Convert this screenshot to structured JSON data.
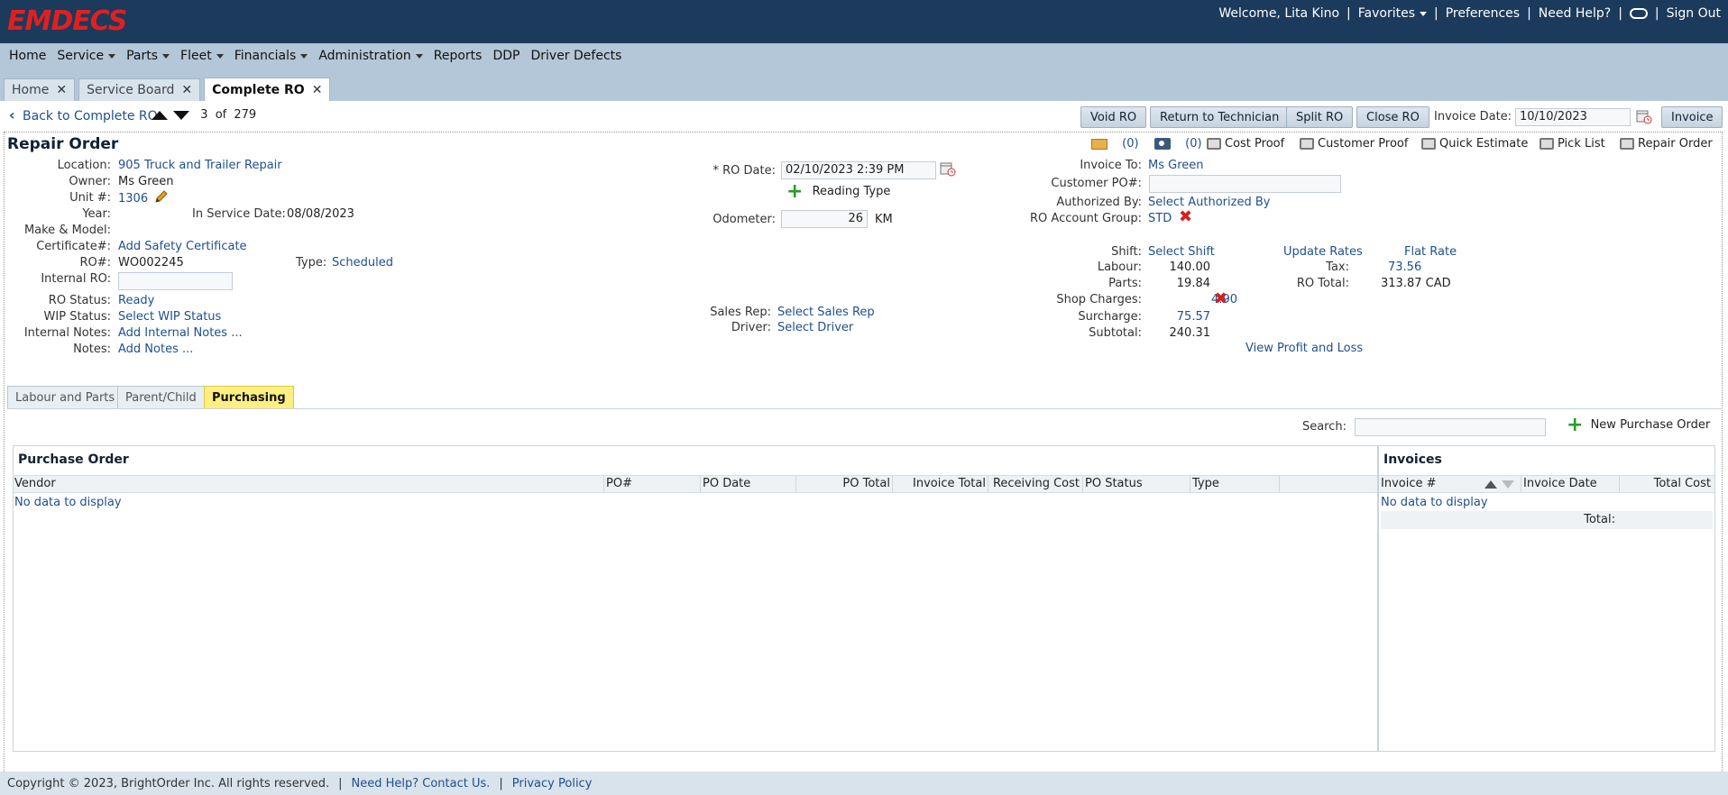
{
  "brand": {
    "logo": "EMDECS",
    "logo_color": "#e02020"
  },
  "topbar": {
    "welcome": "Welcome, Lita Kino",
    "favorites": "Favorites",
    "preferences": "Preferences",
    "help": "Need Help?",
    "signout": "Sign Out"
  },
  "nav": {
    "home": "Home",
    "service": "Service",
    "parts": "Parts",
    "fleet": "Fleet",
    "financials": "Financials",
    "administration": "Administration",
    "reports": "Reports",
    "ddp": "DDP",
    "driver_defects": "Driver Defects"
  },
  "tabs": {
    "home": "Home",
    "service_board": "Service Board",
    "complete_ro": "Complete RO"
  },
  "toolbar": {
    "back": "Back to Complete RO",
    "position": "3",
    "of": "of",
    "total": "279",
    "void": "Void RO",
    "return": "Return to Technician",
    "split": "Split RO",
    "close": "Close RO",
    "invoice_date_label": "Invoice Date:",
    "invoice_date": "10/10/2023",
    "invoice": "Invoice"
  },
  "repair_order": {
    "title": "Repair Order",
    "email_count": "(0)",
    "photo_count": "(0)",
    "print": {
      "cost_proof": "Cost Proof",
      "customer_proof": "Customer Proof",
      "quick_estimate": "Quick Estimate",
      "pick_list": "Pick List",
      "repair_order": "Repair Order"
    },
    "left": {
      "location_label": "Location:",
      "location": "905 Truck and Trailer Repair",
      "owner_label": "Owner:",
      "owner": "Ms Green",
      "unit_label": "Unit #:",
      "unit": "1306",
      "year_label": "Year:",
      "in_service_label": "In Service Date:",
      "in_service": "08/08/2023",
      "make_label": "Make & Model:",
      "cert_label": "Certificate#:",
      "cert": "Add Safety Certificate",
      "ro_label": "RO#:",
      "ro": "WO002245",
      "type_label": "Type:",
      "type": "Scheduled",
      "internal_ro_label": "Internal RO:",
      "status_label": "RO Status:",
      "status": "Ready",
      "wip_label": "WIP Status:",
      "wip": "Select WIP Status",
      "internal_notes_label": "Internal Notes:",
      "internal_notes": "Add Internal Notes ...",
      "notes_label": "Notes:",
      "notes": "Add Notes ..."
    },
    "middle": {
      "ro_date_label": "* RO Date:",
      "ro_date": "02/10/2023 2:39 PM",
      "reading_type": "Reading Type",
      "odometer_label": "Odometer:",
      "odometer": "26",
      "odometer_unit": "KM",
      "sales_rep_label": "Sales Rep:",
      "sales_rep": "Select Sales Rep",
      "driver_label": "Driver:",
      "driver": "Select Driver"
    },
    "right": {
      "invoice_to_label": "Invoice To:",
      "invoice_to": "Ms Green",
      "customer_po_label": "Customer PO#:",
      "authorized_label": "Authorized By:",
      "authorized": "Select Authorized By",
      "account_group_label": "RO Account Group:",
      "account_group": "STD",
      "shift_label": "Shift:",
      "shift": "Select Shift",
      "update_rates": "Update Rates",
      "flat_rate": "Flat Rate",
      "labour_label": "Labour:",
      "labour": "140.00",
      "parts_label": "Parts:",
      "parts": "19.84",
      "shop_label": "Shop Charges:",
      "shop": "4.90",
      "surcharge_label": "Surcharge:",
      "surcharge": "75.57",
      "subtotal_label": "Subtotal:",
      "subtotal": "240.31",
      "tax_label": "Tax:",
      "tax": "73.56",
      "ro_total_label": "RO Total:",
      "ro_total": "313.87 CAD",
      "profit_loss": "View Profit and Loss"
    }
  },
  "subtabs": {
    "labour_parts": "Labour and Parts",
    "parent_child": "Parent/Child",
    "purchasing": "Purchasing"
  },
  "purchasing": {
    "search_label": "Search:",
    "new_po": "New Purchase Order",
    "po_title": "Purchase Order",
    "po_columns": [
      "Vendor",
      "PO#",
      "PO Date",
      "PO Total",
      "Invoice Total",
      "Receiving Cost",
      "PO Status",
      "Type"
    ],
    "po_empty": "No data to display",
    "inv_title": "Invoices",
    "inv_columns": [
      "Invoice #",
      "Invoice Date",
      "Total Cost"
    ],
    "inv_empty": "No data to display",
    "inv_total_label": "Total:"
  },
  "footer": {
    "copyright": "Copyright © 2023, BrightOrder Inc. All rights reserved.",
    "help": "Need Help? Contact Us.",
    "privacy": "Privacy Policy"
  }
}
